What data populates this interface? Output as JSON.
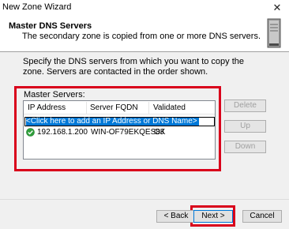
{
  "window": {
    "title": "New Zone Wizard",
    "close_glyph": "✕"
  },
  "header": {
    "title": "Master DNS Servers",
    "subtitle": "The secondary zone is copied from one or more DNS servers.",
    "icon": "server-icon"
  },
  "instructions": "Specify the DNS servers from which you want to copy the zone.  Servers are contacted in the order shown.",
  "group": {
    "label": "Master Servers:"
  },
  "list": {
    "columns": [
      "IP Address",
      "Server FQDN",
      "Validated"
    ],
    "add_placeholder": "<Click here to add an IP Address or DNS Name>",
    "rows": [
      {
        "icon": "check-circle-icon",
        "ip": "192.168.1.200",
        "fqdn": "WIN-OF79EKQES8J",
        "validated": "OK"
      }
    ]
  },
  "side_buttons": {
    "delete": "Delete",
    "up": "Up",
    "down": "Down"
  },
  "nav": {
    "back": "< Back",
    "next": "Next >",
    "cancel": "Cancel"
  },
  "colors": {
    "highlight": "#d9001b",
    "selection": "#0078d7",
    "success": "#2e9e3a"
  }
}
